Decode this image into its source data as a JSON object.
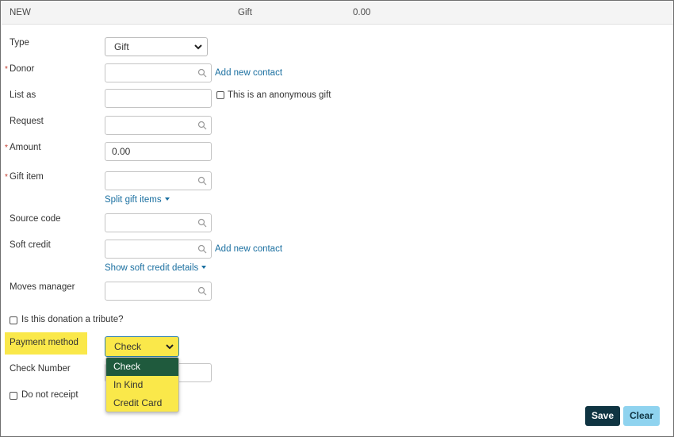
{
  "header": {
    "status": "NEW",
    "type": "Gift",
    "amount": "0.00"
  },
  "form": {
    "type": {
      "label": "Type",
      "value": "Gift"
    },
    "donor": {
      "label": "Donor",
      "value": "",
      "add_link": "Add new contact"
    },
    "list_as": {
      "label": "List as",
      "value": "",
      "anonymous_label": "This is an anonymous gift"
    },
    "request": {
      "label": "Request",
      "value": ""
    },
    "amount": {
      "label": "Amount",
      "value": "0.00"
    },
    "gift_item": {
      "label": "Gift item",
      "value": "",
      "split_link": "Split gift items"
    },
    "source_code": {
      "label": "Source code",
      "value": ""
    },
    "soft_credit": {
      "label": "Soft credit",
      "value": "",
      "add_link": "Add new contact",
      "details_link": "Show soft credit details"
    },
    "moves_manager": {
      "label": "Moves manager",
      "value": ""
    },
    "tribute": {
      "label": "Is this donation a tribute?"
    },
    "payment_method": {
      "label": "Payment method",
      "value": "Check",
      "options": [
        "Check",
        "In Kind",
        "Credit Card"
      ]
    },
    "check_number": {
      "label": "Check Number",
      "value": ""
    },
    "do_not_receipt": {
      "label": "Do not receipt"
    }
  },
  "actions": {
    "save": "Save",
    "clear": "Clear"
  },
  "colors": {
    "highlight": "#fae84a",
    "link": "#1a6fa0",
    "selected_option": "#1f5a3d",
    "save_bg": "#0f3442",
    "clear_bg": "#8fd3ef",
    "required": "#c0392b"
  },
  "icons": {
    "lookup": "search-icon",
    "dropdown": "chevron-down-icon"
  }
}
